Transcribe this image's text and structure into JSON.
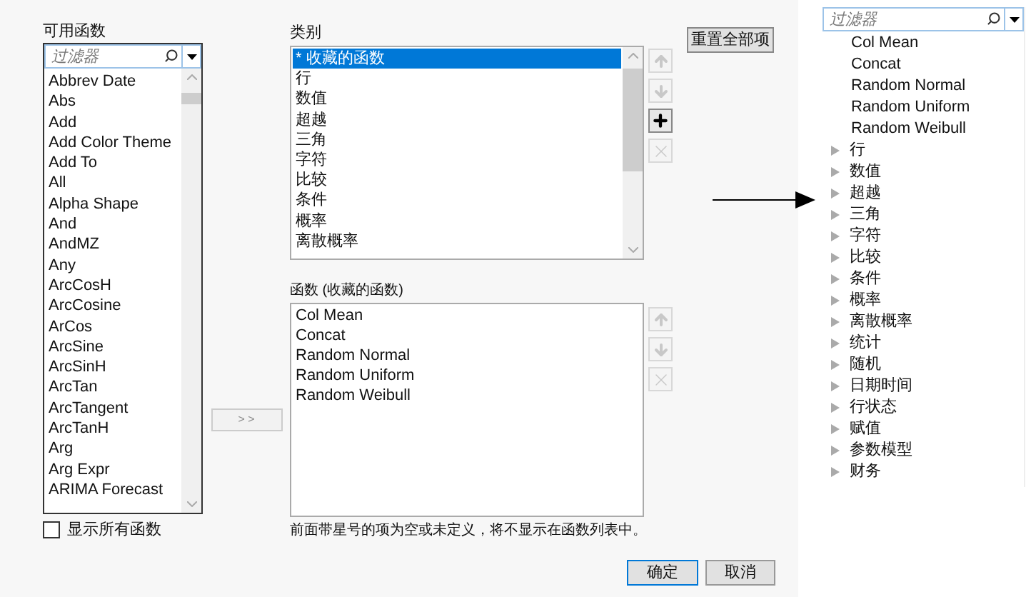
{
  "available": {
    "title": "可用函数",
    "filter": {
      "placeholder": "过滤器"
    },
    "items": [
      "Abbrev Date",
      "Abs",
      "Add",
      "Add Color Theme",
      "Add To",
      "All",
      "Alpha Shape",
      "And",
      "AndMZ",
      "Any",
      "ArcCosH",
      "ArcCosine",
      "ArCos",
      "ArcSine",
      "ArcSinH",
      "ArcTan",
      "ArcTangent",
      "ArcTanH",
      "Arg",
      "Arg Expr",
      "ARIMA Forecast"
    ],
    "show_all": {
      "label": "显示所有函数",
      "checked": false
    }
  },
  "move_button": "> >",
  "categories": {
    "title": "类别",
    "items": [
      {
        "label": "* 收藏的函数",
        "selected": true
      },
      {
        "label": "行",
        "selected": false
      },
      {
        "label": "数值",
        "selected": false
      },
      {
        "label": "超越",
        "selected": false
      },
      {
        "label": "三角",
        "selected": false
      },
      {
        "label": "字符",
        "selected": false
      },
      {
        "label": "比较",
        "selected": false
      },
      {
        "label": "条件",
        "selected": false
      },
      {
        "label": "概率",
        "selected": false
      },
      {
        "label": "离散概率",
        "selected": false
      }
    ],
    "tools": [
      {
        "kind": "up",
        "disabled": true
      },
      {
        "kind": "down",
        "disabled": true
      },
      {
        "kind": "add",
        "disabled": false
      },
      {
        "kind": "delete",
        "disabled": true
      }
    ]
  },
  "reset_button": "重置全部项",
  "functions": {
    "title": "函数 (收藏的函数)",
    "items": [
      "Col Mean",
      "Concat",
      "Random Normal",
      "Random Uniform",
      "Random Weibull"
    ],
    "tools": [
      {
        "kind": "up",
        "disabled": true
      },
      {
        "kind": "down",
        "disabled": true
      },
      {
        "kind": "delete",
        "disabled": true
      }
    ]
  },
  "note": "前面带星号的项为空或未定义，将不显示在函数列表中。",
  "buttons": [
    "确定",
    "取消"
  ],
  "preview": {
    "filter": {
      "placeholder": "过滤器"
    },
    "items": [
      {
        "kind": "function",
        "label": "Col Mean"
      },
      {
        "kind": "function",
        "label": "Concat"
      },
      {
        "kind": "function",
        "label": "Random Normal"
      },
      {
        "kind": "function",
        "label": "Random Uniform"
      },
      {
        "kind": "function",
        "label": "Random Weibull"
      },
      {
        "kind": "category",
        "label": "行",
        "expanded": false
      },
      {
        "kind": "category",
        "label": "数值",
        "expanded": false
      },
      {
        "kind": "category",
        "label": "超越",
        "expanded": false
      },
      {
        "kind": "category",
        "label": "三角",
        "expanded": false
      },
      {
        "kind": "category",
        "label": "字符",
        "expanded": false
      },
      {
        "kind": "category",
        "label": "比较",
        "expanded": false
      },
      {
        "kind": "category",
        "label": "条件",
        "expanded": false
      },
      {
        "kind": "category",
        "label": "概率",
        "expanded": false
      },
      {
        "kind": "category",
        "label": "离散概率",
        "expanded": false
      },
      {
        "kind": "category",
        "label": "统计",
        "expanded": false
      },
      {
        "kind": "category",
        "label": "随机",
        "expanded": false
      },
      {
        "kind": "category",
        "label": "日期时间",
        "expanded": false
      },
      {
        "kind": "category",
        "label": "行状态",
        "expanded": false
      },
      {
        "kind": "category",
        "label": "赋值",
        "expanded": false
      },
      {
        "kind": "category",
        "label": "参数模型",
        "expanded": false
      },
      {
        "kind": "category",
        "label": "财务",
        "expanded": false
      }
    ]
  }
}
